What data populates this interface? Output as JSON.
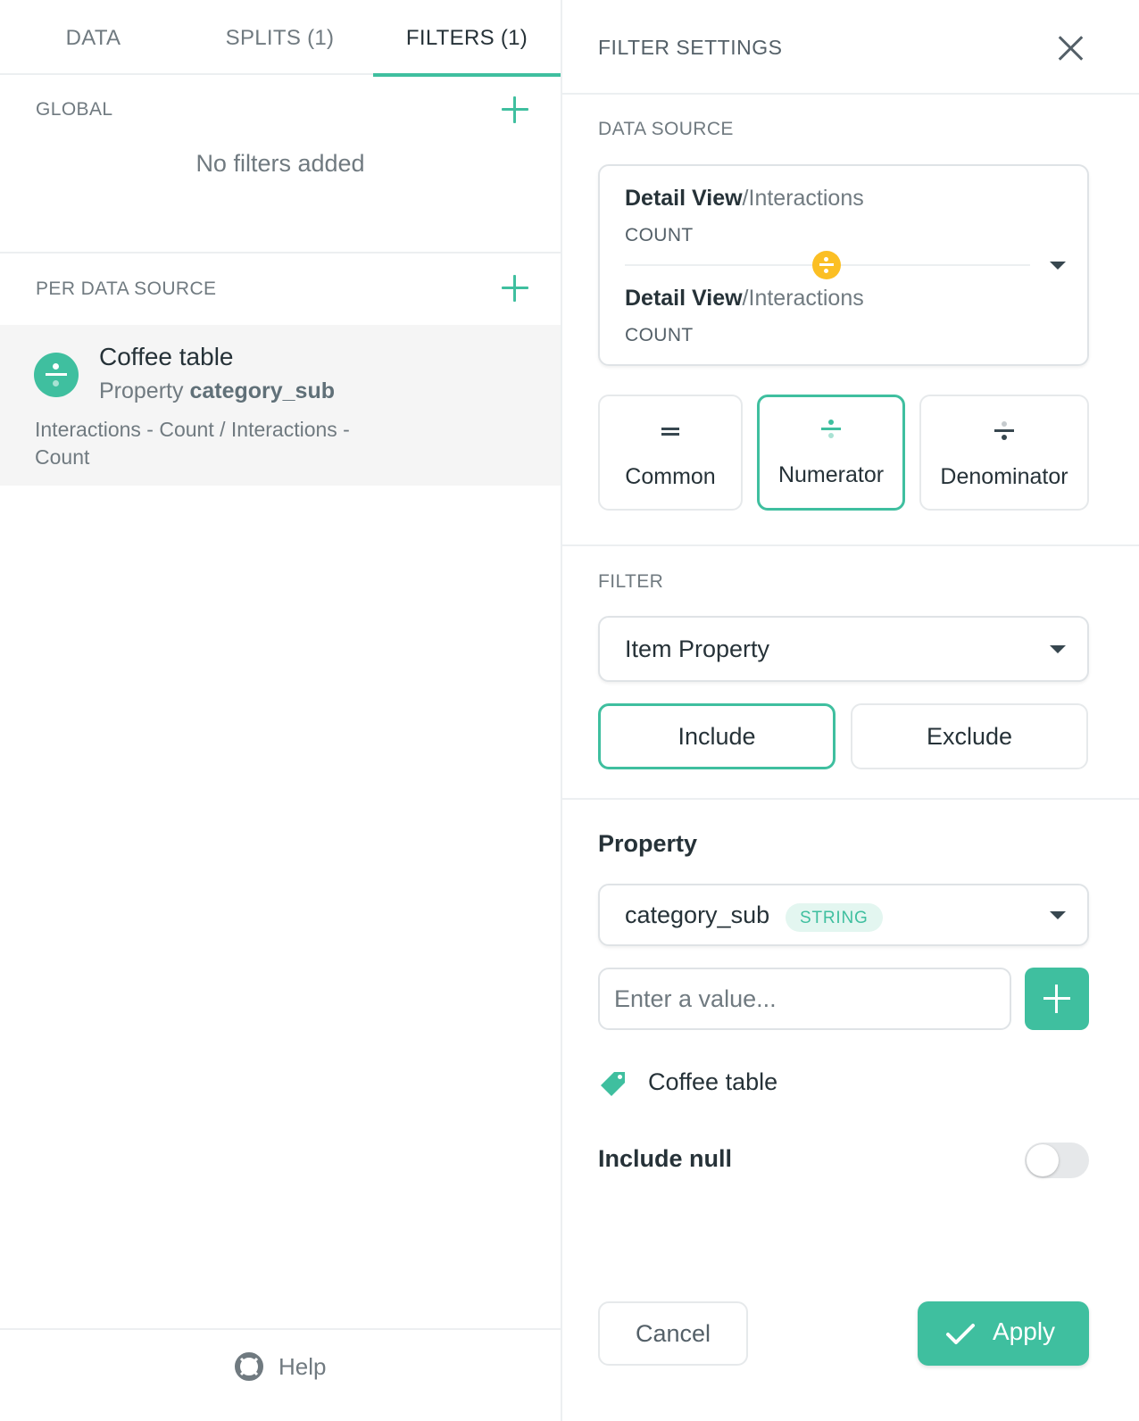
{
  "tabs": [
    {
      "label": "DATA",
      "active": false
    },
    {
      "label": "SPLITS (1)",
      "active": false
    },
    {
      "label": "FILTERS (1)",
      "active": true
    }
  ],
  "global": {
    "label": "GLOBAL",
    "empty_message": "No filters added"
  },
  "per_data_source": {
    "label": "PER DATA SOURCE",
    "items": [
      {
        "icon": "divide-icon",
        "title": "Coffee table",
        "subtitle_prefix": "Property ",
        "subtitle_bold": "category_sub",
        "description": "Interactions - Count / Interactions - Count"
      }
    ]
  },
  "help": {
    "label": "Help",
    "icon": "lifebuoy-icon"
  },
  "filter_settings": {
    "title": "FILTER SETTINGS",
    "data_source": {
      "label": "DATA SOURCE",
      "numerator": {
        "view": "Detail View",
        "table": "/Interactions",
        "metric": "COUNT"
      },
      "denominator": {
        "view": "Detail View",
        "table": "/Interactions",
        "metric": "COUNT"
      },
      "targets": [
        {
          "label": "Common",
          "icon": "equals-icon",
          "active": false
        },
        {
          "label": "Numerator",
          "icon": "numerator-icon",
          "active": true
        },
        {
          "label": "Denominator",
          "icon": "denominator-icon",
          "active": false
        }
      ]
    },
    "filter": {
      "label": "FILTER",
      "type_value": "Item Property",
      "include_label": "Include",
      "exclude_label": "Exclude",
      "mode": "Include"
    },
    "property": {
      "heading": "Property",
      "value": "category_sub",
      "type_badge": "STRING",
      "input_placeholder": "Enter a value...",
      "values": [
        "Coffee table"
      ]
    },
    "include_null": {
      "label": "Include null",
      "enabled": false
    },
    "cancel_label": "Cancel",
    "apply_label": "Apply"
  },
  "colors": {
    "accent": "#3fbf9f",
    "warning": "#fbbf24",
    "text_primary": "#263238",
    "text_secondary": "#707a80"
  }
}
